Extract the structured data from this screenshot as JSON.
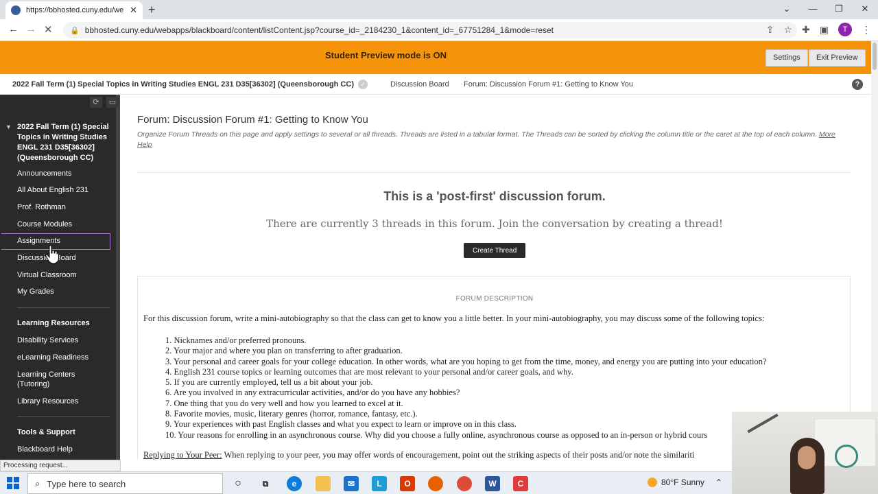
{
  "browser": {
    "tab_title": "https://bbhosted.cuny.edu/weba",
    "url": "bbhosted.cuny.edu/webapps/blackboard/content/listContent.jsp?course_id=_2184230_1&content_id=_67751284_1&mode=reset",
    "profile_initial": "T",
    "status_text": "Processing request..."
  },
  "banner": {
    "message": "Student Preview mode is ON",
    "settings_label": "Settings",
    "exit_label": "Exit Preview"
  },
  "breadcrumb": {
    "course": "2022 Fall Term (1) Special Topics in Writing Studies ENGL 231 D35[36302] (Queensborough CC)",
    "level1": "Discussion Board",
    "level2": "Forum: Discussion Forum #1: Getting to Know You"
  },
  "sidebar": {
    "course_title": "2022 Fall Term (1) Special Topics in Writing Studies ENGL 231 D35[36302] (Queensborough CC)",
    "items": [
      "Announcements",
      "All About English 231",
      "Prof. Rothman",
      "Course Modules",
      "Assignments",
      "Discussion Board",
      "Virtual Classroom",
      "My Grades"
    ],
    "section_learning": "Learning Resources",
    "learning_items": [
      "Disability Services",
      "eLearning Readiness",
      "Learning Centers (Tutoring)",
      "Library Resources"
    ],
    "section_tools": "Tools & Support",
    "tools_items": [
      "Blackboard Help"
    ]
  },
  "page": {
    "title": "Forum: Discussion Forum #1: Getting to Know You",
    "description": "Organize Forum Threads on this page and apply settings to several or all threads. Threads are listed in a tabular format. The Threads can be sorted by clicking the column title or the caret at the top of each column.",
    "more_help": "More Help",
    "headline": "This is a 'post-first' discussion forum.",
    "subline": "There are currently 3 threads in this forum. Join the conversation by creating a thread!",
    "create_button": "Create Thread",
    "forum_description_label": "FORUM DESCRIPTION",
    "intro": "For this discussion forum, write a mini-autobiography so that the class can get to know you a little better. In your mini-autobiography, you may discuss some of the following topics:",
    "topics": [
      "1. Nicknames and/or preferred pronouns.",
      "2. Your major and where you plan on transferring to after graduation.",
      "3. Your personal and career goals for your college education. In other words, what are you hoping to get from the time, money, and energy you are putting into your education?",
      "4. English 231 course topics or learning outcomes that are most relevant to your personal and/or career goals, and why.",
      "5. If you are currently employed, tell us a bit about your job.",
      "6. Are you involved in any extracurricular activities, and/or do you have any hobbies?",
      "7. One thing that you do very well and how you learned to excel at it.",
      "8. Favorite movies, music, literary genres (horror, romance, fantasy, etc.).",
      "9. Your experiences with past English classes and what you expect to learn or improve on in this class.",
      "10. Your reasons for enrolling in an asynchronous course. Why did you choose a fully online, asynchronous course as opposed to an in-person or hybrid cours"
    ],
    "reply_label": "Replying to Your Peer:",
    "reply_text": " When replying to your peer, you may offer words of encouragement, point out the striking aspects of their posts and/or note the similariti"
  },
  "taskbar": {
    "search_placeholder": "Type here to search",
    "weather": "80°F  Sunny"
  }
}
